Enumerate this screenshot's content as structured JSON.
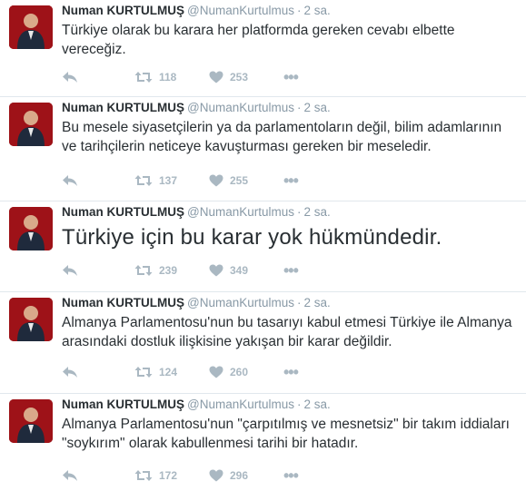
{
  "tweets": [
    {
      "name": "Numan KURTULMUŞ",
      "handle": "@NumanKurtulmus",
      "time": "2 sa.",
      "text": "Türkiye olarak bu karara her platformda gereken cevabı elbette vereceğiz.",
      "retweets": "118",
      "likes": "253"
    },
    {
      "name": "Numan KURTULMUŞ",
      "handle": "@NumanKurtulmus",
      "time": "2 sa.",
      "text": "Bu mesele siyasetçilerin ya da parlamentoların değil, bilim adamlarının ve tarihçilerin neticeye kavuşturması gereken bir meseledir.",
      "retweets": "137",
      "likes": "255"
    },
    {
      "name": "Numan KURTULMUŞ",
      "handle": "@NumanKurtulmus",
      "time": "2 sa.",
      "text": "Türkiye için bu karar yok hükmündedir.",
      "retweets": "239",
      "likes": "349"
    },
    {
      "name": "Numan KURTULMUŞ",
      "handle": "@NumanKurtulmus",
      "time": "2 sa.",
      "text": "Almanya Parlamentosu'nun bu tasarıyı kabul etmesi Türkiye ile Almanya arasındaki dostluk ilişkisine yakışan bir karar değildir.",
      "retweets": "124",
      "likes": "260"
    },
    {
      "name": "Numan KURTULMUŞ",
      "handle": "@NumanKurtulmus",
      "time": "2 sa.",
      "text": "Almanya Parlamentosu'nun \"çarpıtılmış ve mesnetsiz\" bir takım iddiaları \"soykırım\" olarak kabullenmesi tarihi bir hatadır.",
      "retweets": "172",
      "likes": "296"
    }
  ],
  "separator": "·",
  "more_label": "•••",
  "colors": {
    "text": "#292f33",
    "muted": "#8899a6",
    "action": "#aab8c2",
    "divider": "#e1e8ed",
    "flag_red": "#c8102e"
  },
  "icons": {
    "reply": "reply-icon",
    "retweet": "retweet-icon",
    "like": "heart-icon",
    "more": "more-dots-icon"
  }
}
